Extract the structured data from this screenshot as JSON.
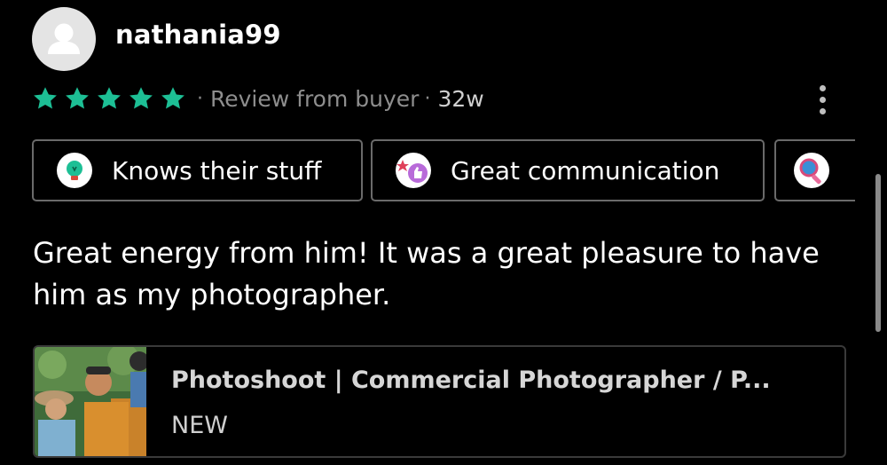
{
  "review": {
    "username": "nathania99",
    "rating": 5,
    "review_from": "Review from buyer",
    "time_ago": "32w",
    "separator": "·",
    "text": "Great energy from him! It was a great pleasure to have him as my photographer."
  },
  "tags": [
    {
      "label": "Knows their stuff",
      "icon": "lightbulb-badge-icon"
    },
    {
      "label": "Great communication",
      "icon": "thumbs-up-badge-icon"
    },
    {
      "label": "",
      "icon": "magnifier-badge-icon"
    }
  ],
  "gig": {
    "title": "Photoshoot | Commercial Photographer / P...",
    "badge": "NEW"
  },
  "colors": {
    "background": "#000000",
    "star": "#1dbf95",
    "muted_text": "#8e8e8e",
    "border": "#6a6a6a"
  }
}
